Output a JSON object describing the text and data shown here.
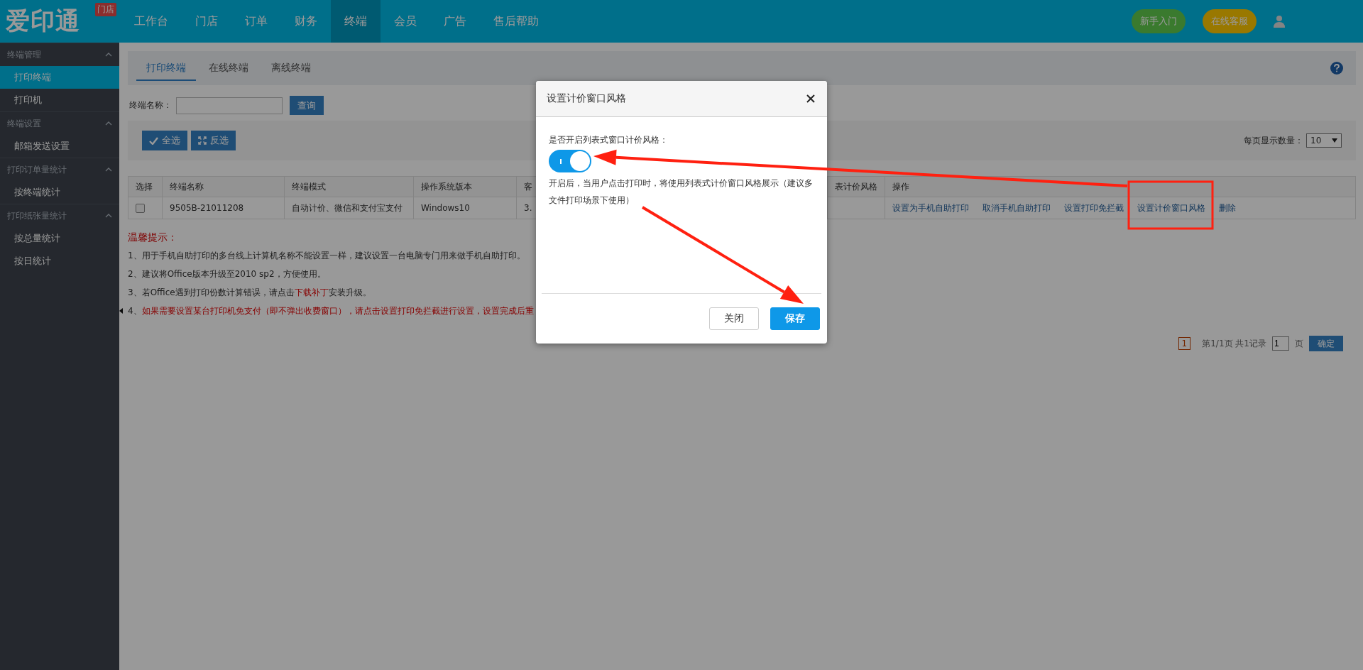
{
  "header": {
    "logo": "爱印通",
    "logo_badge": "门店",
    "nav": [
      {
        "label": "工作台",
        "selected": false
      },
      {
        "label": "门店",
        "selected": false
      },
      {
        "label": "订单",
        "selected": false
      },
      {
        "label": "财务",
        "selected": false
      },
      {
        "label": "终端",
        "selected": true
      },
      {
        "label": "会员",
        "selected": false
      },
      {
        "label": "广告",
        "selected": false
      },
      {
        "label": "售后帮助",
        "selected": false
      }
    ],
    "buttons": [
      {
        "label": "新手入门",
        "kind": "guide"
      },
      {
        "label": "在线客服",
        "kind": "service"
      }
    ]
  },
  "sidebar": [
    {
      "title": "终端管理",
      "expanded": true,
      "items": [
        {
          "label": "打印终端",
          "selected": true
        },
        {
          "label": "打印机",
          "selected": false
        }
      ]
    },
    {
      "title": "终端设置",
      "expanded": true,
      "items": [
        {
          "label": "邮箱发送设置",
          "selected": false
        }
      ]
    },
    {
      "title": "打印订单量统计",
      "expanded": true,
      "items": [
        {
          "label": "按终端统计",
          "selected": false
        }
      ]
    },
    {
      "title": "打印纸张量统计",
      "expanded": true,
      "items": [
        {
          "label": "按总量统计",
          "selected": false
        },
        {
          "label": "按日统计",
          "selected": false
        }
      ]
    }
  ],
  "tabs": [
    {
      "label": "打印终端",
      "selected": true
    },
    {
      "label": "在线终端",
      "selected": false
    },
    {
      "label": "离线终端",
      "selected": false
    }
  ],
  "search": {
    "label": "终端名称：",
    "button": "查询"
  },
  "toolbar": {
    "buttons": [
      {
        "label": "全选",
        "kind": "check"
      },
      {
        "label": "反选",
        "kind": "invert"
      }
    ],
    "page_size_label": "每页显示数量：",
    "page_size": "10"
  },
  "table": {
    "columns": [
      "选择",
      "终端名称",
      "终端模式",
      "操作系统版本",
      "客",
      "表计价风格",
      "操作"
    ],
    "rows": [
      {
        "checked": false,
        "name": "9505B-21011208",
        "mode": "自动计价、微信和支付宝支付",
        "os": "Windows10",
        "column_5": "3.",
        "actions": [
          "设置为手机自助打印",
          "取消手机自助打印",
          "设置打印免拦截",
          "设置计价窗口风格",
          "删除"
        ]
      }
    ]
  },
  "tips": {
    "title": "温馨提示：",
    "items": [
      {
        "segments": [
          {
            "kind": "plain",
            "text": "1、用于手机自助打印的多台线上计算机名称不能设置一样，建议设置一台电脑专门用来做手机自助打印。"
          }
        ]
      },
      {
        "segments": [
          {
            "kind": "plain",
            "text": "2、建议将Office版本升级至2010 sp2，方便使用。"
          }
        ]
      },
      {
        "segments": [
          {
            "kind": "plain",
            "text": "3、若Office遇到打印份数计算错误，请点击"
          },
          {
            "kind": "link",
            "text": "下载补丁"
          },
          {
            "kind": "plain",
            "text": "安装升级。"
          }
        ]
      },
      {
        "segments": [
          {
            "kind": "plain",
            "text": "4、"
          },
          {
            "kind": "warning",
            "text": "如果需要设置某台打印机免支付（即不弹出收费窗口），请点击设置打印免拦截进行设置，设置完成后重"
          }
        ]
      }
    ]
  },
  "pagination": {
    "pages": [
      {
        "label": "1",
        "selected": true
      }
    ],
    "summary": "第1/1页 共1记录",
    "page_input": "1",
    "page_unit": "页",
    "button": "确定"
  },
  "dialog": {
    "title": "设置计价窗口风格",
    "label": "是否开启列表式窗口计价风格：",
    "switch_on": true,
    "description": "开启后，当用户点击打印时，将使用列表式计价窗口风格展示（建议多文件打印场景下使用）",
    "buttons": [
      {
        "label": "关闭",
        "kind": "secondary"
      },
      {
        "label": "保存",
        "kind": "primary"
      }
    ]
  }
}
